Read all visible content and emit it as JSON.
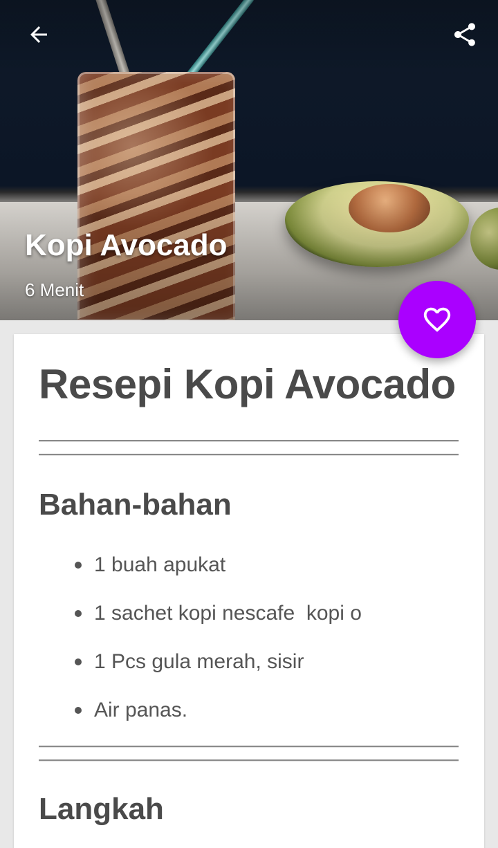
{
  "header": {
    "title": "Kopi Avocado",
    "duration": "6 Menit",
    "back_icon": "arrow-left-icon",
    "share_icon": "share-icon"
  },
  "fab": {
    "icon": "heart-outline-icon",
    "color": "#aa00ff"
  },
  "content": {
    "title": "Resepi Kopi Avocado",
    "ingredients_heading": "Bahan-bahan",
    "ingredients": [
      "1 buah apukat",
      "1 sachet kopi nescafe  kopi o",
      "1 Pcs gula merah, sisir",
      "Air panas."
    ],
    "steps_heading": "Langkah"
  }
}
